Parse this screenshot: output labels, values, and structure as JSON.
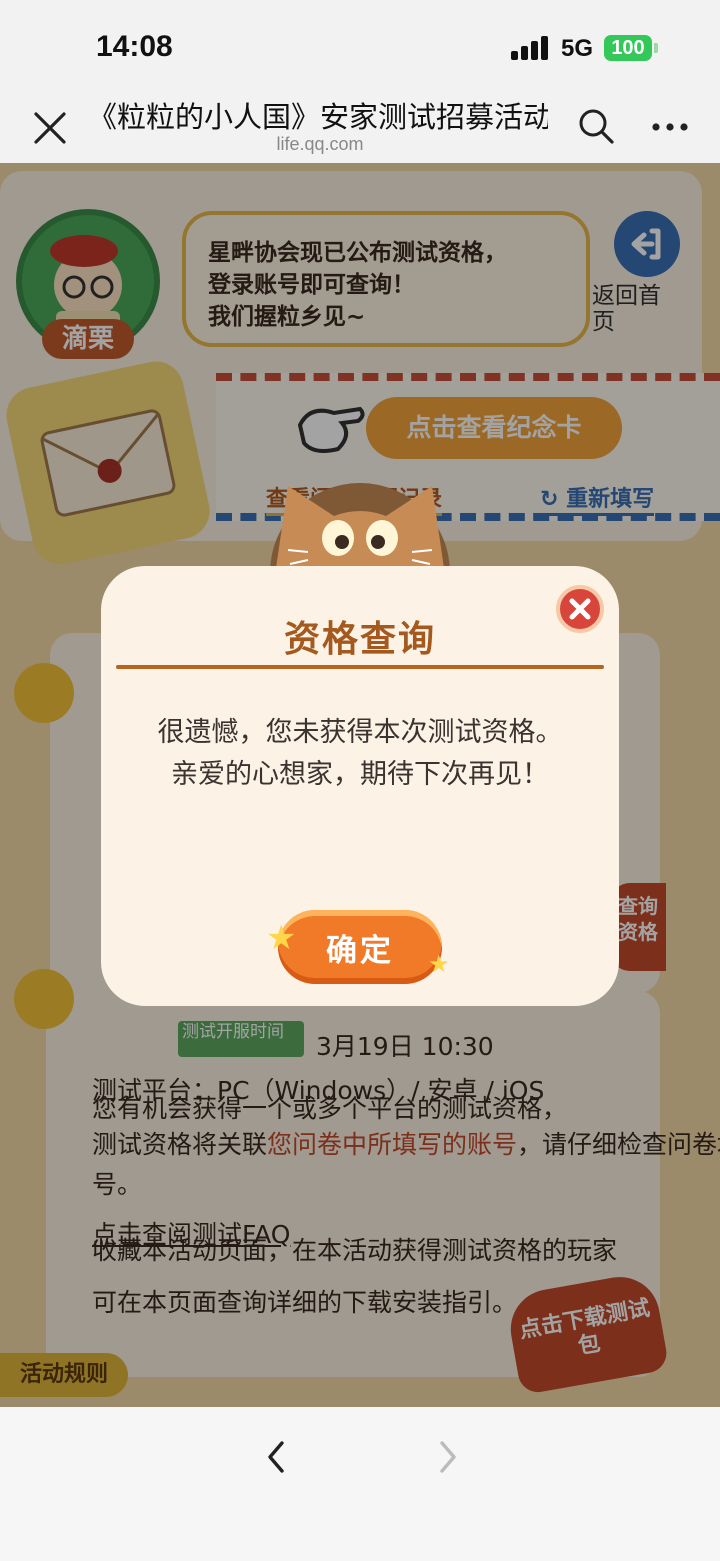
{
  "status_bar": {
    "time": "14:08",
    "network": "5G",
    "battery": "100",
    "icons": [
      "signal-icon",
      "battery-icon"
    ]
  },
  "nav_bar": {
    "title": "《粒粒的小人国》安家测试招募活动",
    "domain": "life.qq.com",
    "icons": [
      "close-icon",
      "search-icon",
      "more-icon"
    ]
  },
  "page": {
    "avatar_name": "滴栗",
    "speech_bubble": [
      "星畔协会现已公布测试资格，",
      "登录账号即可查询！",
      "我们握粒乡见~"
    ],
    "back_home_label": "返回首页",
    "memorial_card_button": "点击查看纪念卡",
    "view_record_link": "查看问卷填写记录",
    "refill_link": "重新填写",
    "server_open_tag": "测试开服时间",
    "server_open_time": "3月19日  10:30",
    "platform_line": "测试平台：PC（Windows）/ 安卓 / iOS",
    "note_line1": "您有机会获得一个或多个平台的测试资格，",
    "note_line2a": "测试资格将关联",
    "note_line2b": "您问卷中所填写的账号",
    "note_line2c": "，请仔细检查问卷填写",
    "note_line3": "号。",
    "faq_link": "点击查阅测试FAQ",
    "collect_line1": "收藏本活动页面，在本活动获得测试资格的玩家",
    "collect_line2": "可在本页面查询详细的下载安装指引。",
    "rules_tab": "活动规则",
    "download_button": "点击下载测试包",
    "side_badge": "查询资格"
  },
  "modal": {
    "title": "资格查询",
    "message_line1": "很遗憾，您未获得本次测试资格。",
    "message_line2": "亲爱的心想家，期待下次再见！",
    "confirm_label": "确定",
    "close_icon": "close-icon"
  },
  "toolbar": {
    "icons": [
      "back-arrow-icon",
      "forward-arrow-icon"
    ]
  },
  "colors": {
    "modal_bg": "#fcf3e6",
    "modal_title": "#a45a1f",
    "confirm_button": "#f07a28",
    "close_button": "#d8453a",
    "battery": "#34c759"
  }
}
